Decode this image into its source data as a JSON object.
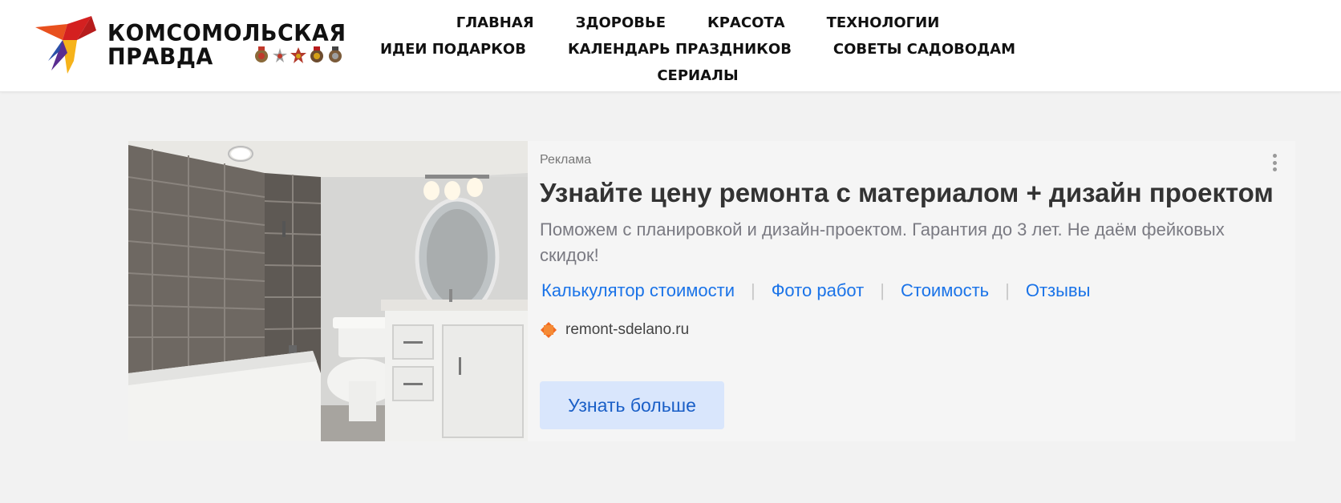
{
  "header": {
    "logo": {
      "line1": "КОМСОМОЛЬСКАЯ",
      "line2": "ПРАВДА"
    },
    "nav": {
      "row1": [
        "ГЛАВНАЯ",
        "ЗДОРОВЬЕ",
        "КРАСОТА",
        "ТЕХНОЛОГИИ"
      ],
      "row2": [
        "ИДЕИ ПОДАРКОВ",
        "КАЛЕНДАРЬ ПРАЗДНИКОВ",
        "СОВЕТЫ САДОВОДАМ"
      ],
      "row3": [
        "СЕРИАЛЫ"
      ]
    }
  },
  "ad": {
    "label": "Реклама",
    "title": "Узнайте цену ремонта с материалом + дизайн проектом",
    "text": "Поможем с планировкой и дизайн-проектом. Гарантия до 3 лет. Не даём фейковых скидок!",
    "links": [
      "Калькулятор стоимости",
      "Фото работ",
      "Стоимость",
      "Отзывы"
    ],
    "domain": "remont-sdelano.ru",
    "button": "Узнать больше"
  },
  "colors": {
    "accent": "#1a73e8",
    "button_bg": "#d9e6fc",
    "page_bg": "#f2f2f2",
    "logo_red": "#e30613"
  }
}
